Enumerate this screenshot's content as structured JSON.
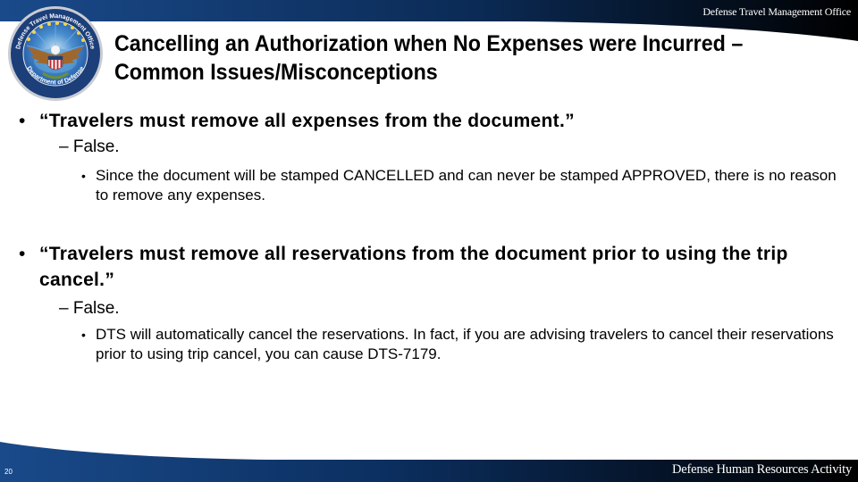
{
  "header": {
    "organization": "Defense Travel Management Office",
    "gradient_colors": [
      "#1a4a8a",
      "#0a2a55",
      "#000000"
    ]
  },
  "seal": {
    "top_text": "Defense Travel Management Office",
    "bottom_text": "Department of Defense",
    "colors": {
      "ring": "#1c3f7a",
      "inner": "#2a66b5",
      "eagle": "#a0672c",
      "shield_red": "#c0272d"
    }
  },
  "slide": {
    "title": "Cancelling an Authorization when No Expenses were Incurred – Common Issues/Misconceptions",
    "items": [
      {
        "claim": "“Travelers must remove all expenses from the document.”",
        "verdict": "– False.",
        "explanation": "Since the document will be stamped CANCELLED and can never be stamped APPROVED, there is no reason to remove any expenses."
      },
      {
        "claim": "“Travelers must remove all reservations from the document prior to using the trip cancel.”",
        "verdict": "– False.",
        "explanation": "DTS will automatically cancel the reservations. In fact, if you are advising travelers to cancel their reservations prior to using trip cancel, you can cause DTS-7179."
      }
    ],
    "bullet_glyph": "•"
  },
  "footer": {
    "page_number": "20",
    "organization": "Defense Human Resources Activity",
    "gradient_colors": [
      "#1a4a8a",
      "#0a2a55",
      "#000000"
    ]
  }
}
